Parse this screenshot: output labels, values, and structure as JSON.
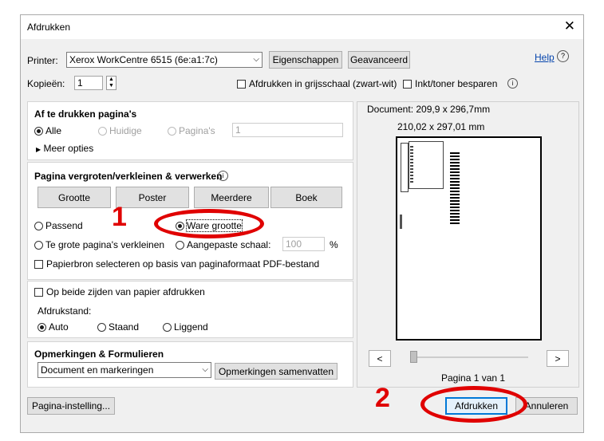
{
  "dialog": {
    "title": "Afdrukken"
  },
  "printer": {
    "label": "Printer:",
    "value": "Xerox WorkCentre 6515 (6e:a1:7c)",
    "properties_btn": "Eigenschappen",
    "advanced_btn": "Geavanceerd",
    "help": "Help"
  },
  "copies": {
    "label": "Kopieën:",
    "value": "1",
    "grayscale": "Afdrukken in grijsschaal (zwart-wit)",
    "save_ink": "Inkt/toner besparen"
  },
  "pages": {
    "heading": "Af te drukken pagina's",
    "all": "Alle",
    "current": "Huidige",
    "pages": "Pagina's",
    "pages_value": "1",
    "more": "Meer opties"
  },
  "sizing": {
    "heading": "Pagina vergroten/verkleinen & verwerken",
    "tabs": [
      "Grootte",
      "Poster",
      "Meerdere",
      "Boek"
    ],
    "fit": "Passend",
    "actual": "Ware grootte",
    "shrink": "Te grote pagina's verkleinen",
    "custom": "Aangepaste schaal:",
    "scale_value": "100",
    "percent": "%",
    "paper_source": "Papierbron selecteren op basis van paginaformaat PDF-bestand"
  },
  "duplex": {
    "label": "Op beide zijden van papier afdrukken",
    "orientation_label": "Afdrukstand:",
    "auto": "Auto",
    "portrait": "Staand",
    "landscape": "Liggend"
  },
  "comments": {
    "heading": "Opmerkingen & Formulieren",
    "value": "Document en markeringen",
    "summarize_btn": "Opmerkingen samenvatten"
  },
  "preview": {
    "document_size": "Document: 209,9 x 296,7mm",
    "paper_size": "210,02 x 297,01 mm",
    "prev": "<",
    "next": ">",
    "page_info": "Pagina 1 van 1"
  },
  "footer": {
    "page_setup": "Pagina-instelling...",
    "print": "Afdrukken",
    "cancel": "Annuleren"
  },
  "annotations": {
    "one": "1",
    "two": "2"
  },
  "colors": {
    "annotation": "#e00000",
    "primary_border": "#0078d7"
  }
}
